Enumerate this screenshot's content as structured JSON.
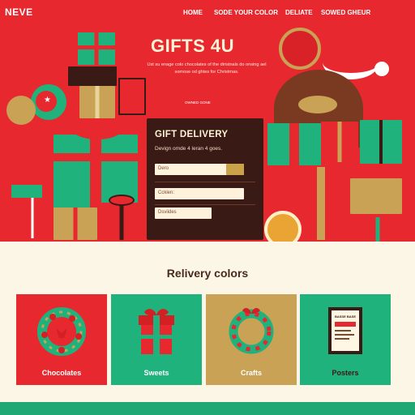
{
  "brand": "NEVE",
  "nav": [
    "HOME",
    "SODE YOUR COLOR",
    "DELIATE",
    "SOWED GHEUR"
  ],
  "hero": {
    "title": "GIFTS 4U",
    "subtitle": "Ust su enage colo chocolates of the diristnals do onsing ael somose od ghtes for Christmas.",
    "tagline": "OWNED GONE"
  },
  "card": {
    "title": "GIFT DELIVERY",
    "subtitle": "Devign omde 4 leran 4 goes.",
    "fields": [
      "Dero",
      "Ccklen:",
      "Dsviides"
    ]
  },
  "section": {
    "title": "Relivery colors",
    "tiles": [
      {
        "label": "Chocolates",
        "bg": "#e8282f",
        "fg": "#ffffff",
        "icon": "wreath-icon"
      },
      {
        "label": "Sweets",
        "bg": "#1fb27c",
        "fg": "#ffffff",
        "icon": "gift-box-icon"
      },
      {
        "label": "Crafts",
        "bg": "#c9a256",
        "fg": "#ffffff",
        "icon": "wreath-icon"
      },
      {
        "label": "Posters",
        "bg": "#1fb27c",
        "fg": "#3a1a14",
        "icon": "poster-icon"
      }
    ],
    "poster_heading": "BASSE BASE"
  },
  "colors": {
    "accent_red": "#e8282f",
    "accent_green": "#1fb27c",
    "accent_gold": "#c9a256",
    "card_dark": "#3a1a14",
    "cream": "#fbf6e6"
  }
}
